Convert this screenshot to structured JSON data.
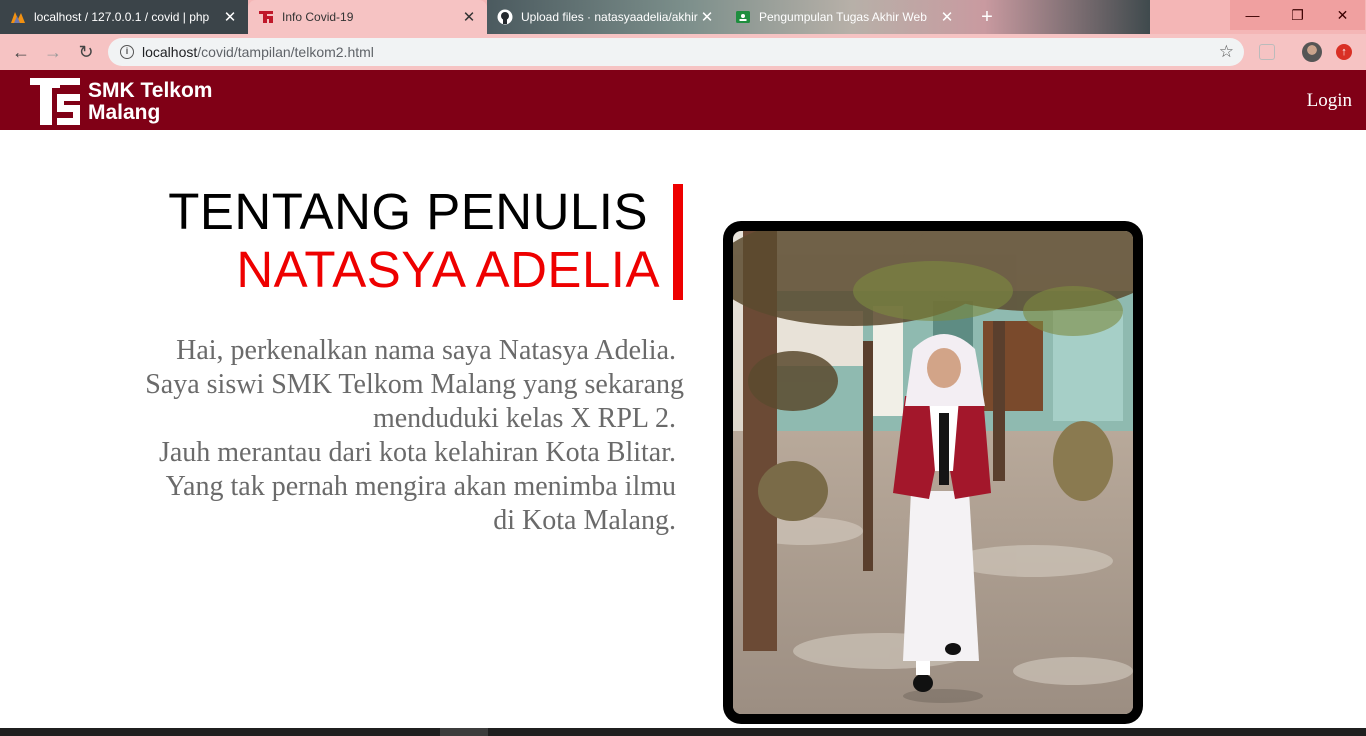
{
  "browser": {
    "tabs": [
      {
        "label": "localhost / 127.0.0.1 / covid | php",
        "icon": "phpmyadmin-icon",
        "active": false
      },
      {
        "label": "Info Covid-19",
        "icon": "telkom-favicon-icon",
        "active": true
      },
      {
        "label": "Upload files · natasyaadelia/akhir",
        "icon": "github-icon",
        "active": false
      },
      {
        "label": "Pengumpulan Tugas Akhir Web",
        "icon": "google-classroom-icon",
        "active": false
      }
    ],
    "address": {
      "host": "localhost",
      "path": "/covid/tampilan/telkom2.html"
    }
  },
  "header": {
    "logo_line1": "SMK Telkom",
    "logo_line2": "Malang",
    "login": "Login",
    "background": "#800016"
  },
  "content": {
    "title_line1": "TENTANG PENULIS",
    "title_line2": "NATASYA ADELIA",
    "accent_color": "#ee0000",
    "bio": [
      "Hai, perkenalkan nama saya Natasya Adelia.",
      "Saya siswi SMK Telkom Malang yang sekarang",
      "menduduki kelas X RPL 2.",
      "Jauh merantau dari kota kelahiran Kota Blitar.",
      "Yang tak pernah mengira akan menimba ilmu",
      "di Kota Malang."
    ]
  }
}
